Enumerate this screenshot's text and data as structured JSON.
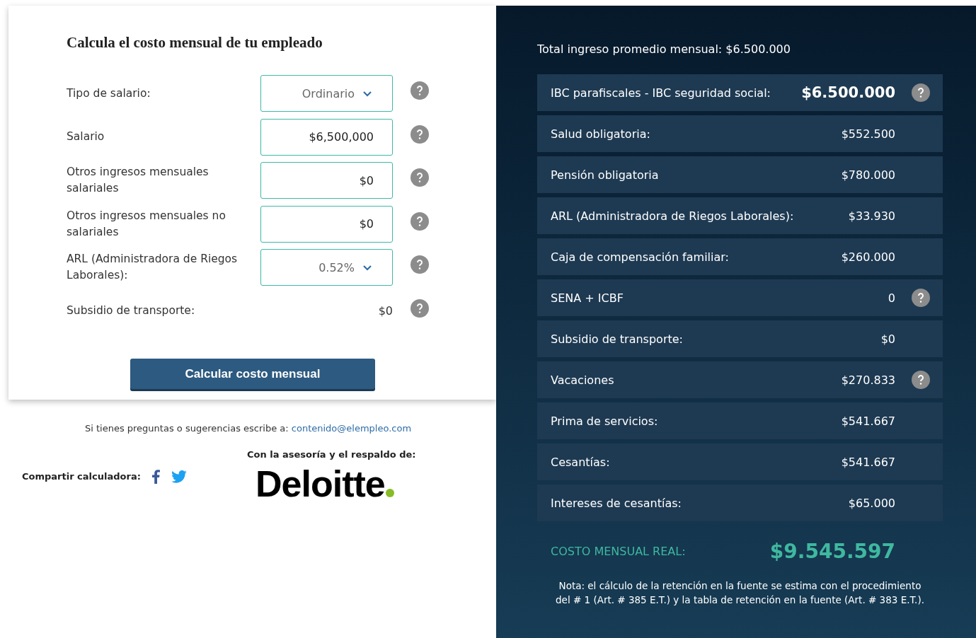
{
  "form": {
    "title": "Calcula el costo mensual de tu empleado",
    "fields": [
      {
        "label": "Tipo de salario:",
        "kind": "select",
        "value": "Ordinario",
        "help": true
      },
      {
        "label": "Salario",
        "kind": "input",
        "value": "$6,500,000",
        "help": true
      },
      {
        "label": "Otros ingresos mensuales salariales",
        "kind": "input",
        "value": "$0",
        "help": true
      },
      {
        "label": "Otros ingresos mensuales no salariales",
        "kind": "input",
        "value": "$0",
        "help": true
      },
      {
        "label": "ARL (Administradora de Riegos Laborales):",
        "kind": "select",
        "value": "0.52%",
        "help": true
      },
      {
        "label": "Subsidio de transporte:",
        "kind": "text",
        "value": "$0",
        "help": true
      }
    ],
    "button": "Calcular costo mensual"
  },
  "footer": {
    "contact": "Si tienes preguntas o sugerencias escribe a:",
    "email": "contenido@elempleo.com",
    "share": "Compartir calculadora:",
    "sponsor": "Con la asesoría y el respaldo de:",
    "logo": "Deloitte"
  },
  "results": {
    "total": "Total ingreso promedio mensual: $6.500.000",
    "rows": [
      {
        "label": "IBC parafiscales - IBC seguridad social:",
        "value": "$6.500.000",
        "emphasis": true,
        "help": true
      },
      {
        "label": "Salud obligatoria:",
        "value": "$552.500",
        "emphasis": false,
        "help": false
      },
      {
        "label": "Pensión obligatoria",
        "value": "$780.000",
        "emphasis": false,
        "help": false
      },
      {
        "label": "ARL (Administradora de Riegos Laborales):",
        "value": "$33.930",
        "emphasis": false,
        "help": false
      },
      {
        "label": "Caja de compensación familiar:",
        "value": "$260.000",
        "emphasis": false,
        "help": false
      },
      {
        "label": "SENA + ICBF",
        "value": "0",
        "emphasis": false,
        "help": true
      },
      {
        "label": "Subsidio de transporte:",
        "value": "$0",
        "emphasis": false,
        "help": false
      },
      {
        "label": "Vacaciones",
        "value": "$270.833",
        "emphasis": false,
        "help": true
      },
      {
        "label": "Prima de servicios:",
        "value": "$541.667",
        "emphasis": false,
        "help": false
      },
      {
        "label": "Cesantías:",
        "value": "$541.667",
        "emphasis": false,
        "help": false
      },
      {
        "label": "Intereses de cesantías:",
        "value": "$65.000",
        "emphasis": false,
        "help": false
      }
    ],
    "cost_label": "COSTO MENSUAL REAL:",
    "cost_value": "$9.545.597",
    "note": "Nota: el cálculo de la retención en la fuente se estima con el procedimiento del # 1 (Art. # 385 E.T.) y la tabla de retención en la fuente (Art. # 383 E.T.)."
  }
}
